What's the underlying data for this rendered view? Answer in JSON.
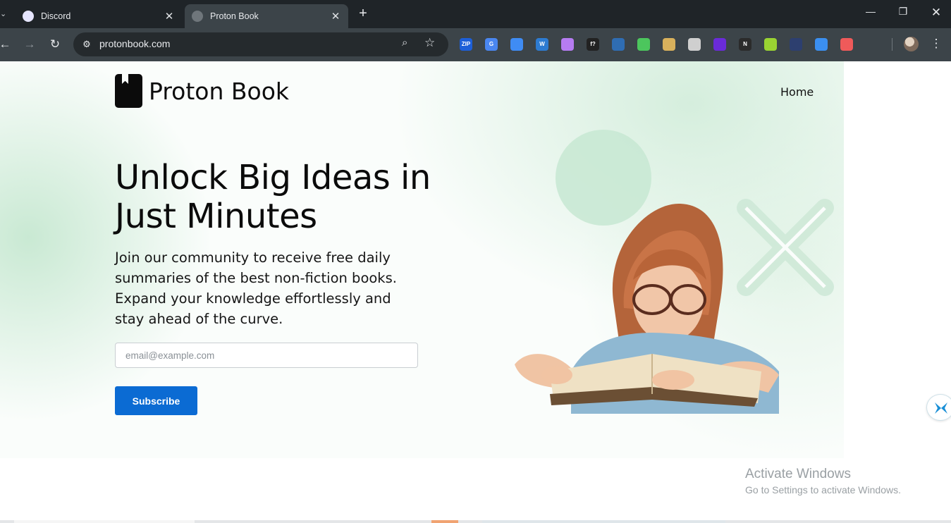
{
  "browser": {
    "tabs": [
      {
        "title": "Discord",
        "active": false,
        "favicon_color": "#e6e6ff"
      },
      {
        "title": "Proton Book",
        "active": true,
        "favicon_color": "#6f767b"
      }
    ],
    "new_tab_label": "+",
    "address": "protonbook.com",
    "extensions": [
      {
        "name": "zip-icon",
        "label": "ZIP",
        "color": "#1d5fd8"
      },
      {
        "name": "translate-icon",
        "label": "G",
        "color": "#4a86f0"
      },
      {
        "name": "circle-target-icon",
        "label": "",
        "color": "#3f8cf4"
      },
      {
        "name": "wordpress-icon",
        "label": "W",
        "color": "#2d7bd1"
      },
      {
        "name": "pen-icon",
        "label": "",
        "color": "#b67cf2"
      },
      {
        "name": "formula-icon",
        "label": "f?",
        "color": "#222"
      },
      {
        "name": "globe-icon",
        "label": "",
        "color": "#2f6db3"
      },
      {
        "name": "green-ball-icon",
        "label": "",
        "color": "#4cc65d"
      },
      {
        "name": "image-icon",
        "label": "",
        "color": "#d9b15c"
      },
      {
        "name": "camera-icon",
        "label": "",
        "color": "#cfcfcf"
      },
      {
        "name": "gem-icon",
        "label": "",
        "color": "#6a2bd9"
      },
      {
        "name": "notion-icon",
        "label": "N",
        "color": "#2b2b2b"
      },
      {
        "name": "bulb-icon",
        "label": "",
        "color": "#9ad332"
      },
      {
        "name": "robot-icon",
        "label": "",
        "color": "#2d3f6f"
      },
      {
        "name": "download-icon",
        "label": "",
        "color": "#3b8ff0"
      },
      {
        "name": "color-ring-icon",
        "label": "",
        "color": "#ef5a5a"
      },
      {
        "name": "puzzle-icon",
        "label": "",
        "color": "#3c4449"
      }
    ]
  },
  "site": {
    "brand": "Proton Book",
    "nav": {
      "home": "Home"
    },
    "hero": {
      "headline": "Unlock Big Ideas in Just Minutes",
      "subtext": "Join our community to receive free daily summaries of the best non-fiction books. Expand your knowledge effortlessly and stay ahead of the curve.",
      "email_placeholder": "email@example.com",
      "subscribe_label": "Subscribe"
    },
    "accent_color": "#0b6bd3"
  },
  "os_overlay": {
    "title": "Activate Windows",
    "subtitle": "Go to Settings to activate Windows."
  }
}
